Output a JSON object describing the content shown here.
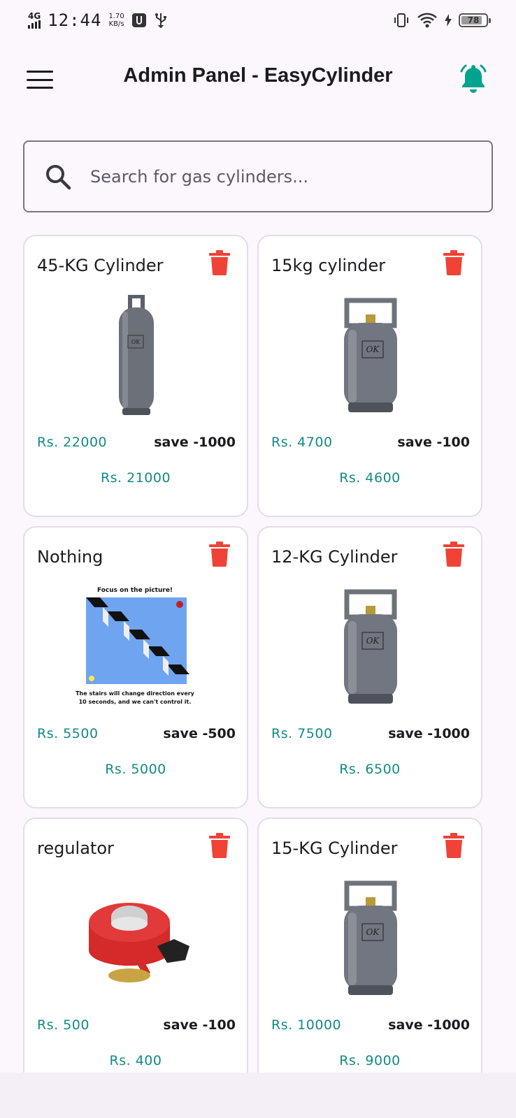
{
  "status_bar": {
    "network": "4G",
    "time": "12:44",
    "speed_value": "1.70",
    "speed_unit": "KB/s",
    "battery": "78",
    "battery_level": 0.78
  },
  "app_bar": {
    "title": "Admin Panel - EasyCylinder",
    "menu_icon": "menu-icon",
    "notification_icon": "bell-icon",
    "accent_color": "#00a38d"
  },
  "search": {
    "placeholder": "Search for gas cylinders..."
  },
  "colors": {
    "price": "#138a83",
    "delete": "#f04236",
    "background": "#fcf6fd"
  },
  "products": [
    {
      "name": "45-KG Cylinder",
      "price": "Rs. 22000",
      "save": "save -1000",
      "final": "Rs. 21000",
      "image": "tall-gas-cylinder"
    },
    {
      "name": "15kg cylinder",
      "price": "Rs. 4700",
      "save": "save -100",
      "final": "Rs. 4600",
      "image": "gas-cylinder"
    },
    {
      "name": "Nothing",
      "price": "Rs. 5500",
      "save": "save -500",
      "final": "Rs. 5000",
      "image": "stairs-illusion",
      "image_caption_top": "Focus on the picture!",
      "image_caption_bottom_1": "The stairs will change direction every",
      "image_caption_bottom_2": "10 seconds, and we can't control it."
    },
    {
      "name": "12-KG Cylinder",
      "price": "Rs. 7500",
      "save": "save -1000",
      "final": "Rs. 6500",
      "image": "gas-cylinder"
    },
    {
      "name": "regulator",
      "price": "Rs. 500",
      "save": "save -100",
      "final": "Rs. 400",
      "image": "gas-regulator"
    },
    {
      "name": "15-KG Cylinder",
      "price": "Rs. 10000",
      "save": "save -1000",
      "final": "Rs. 9000",
      "image": "gas-cylinder"
    }
  ]
}
